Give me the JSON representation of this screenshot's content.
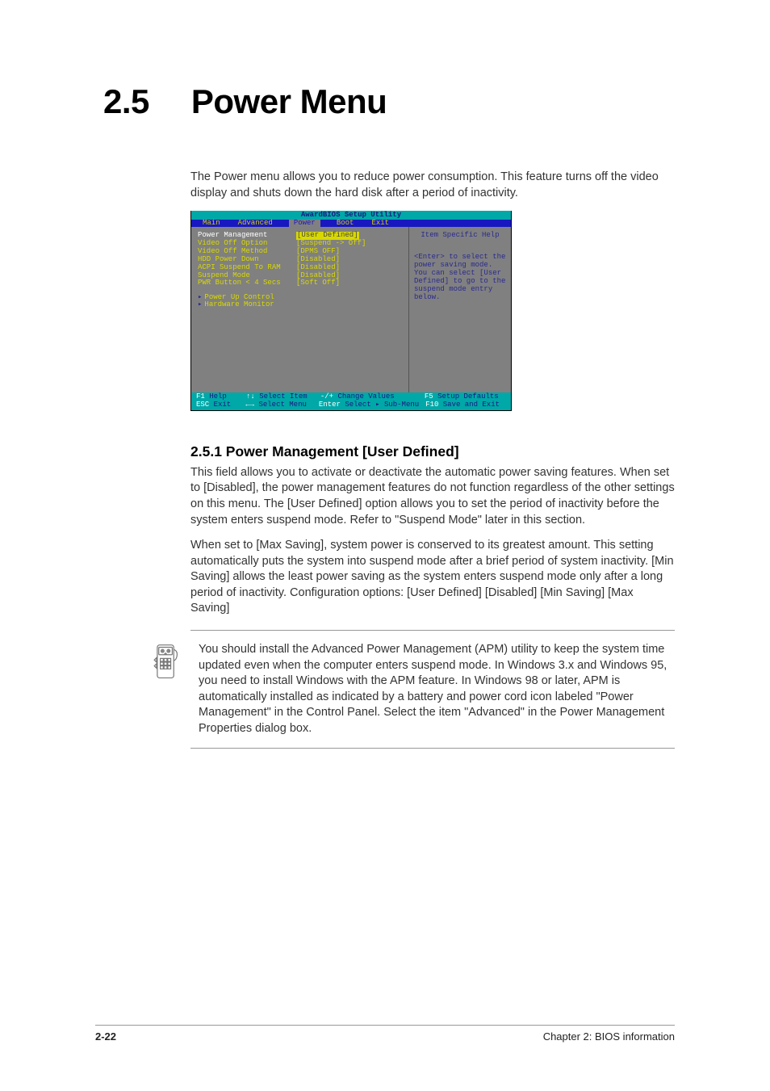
{
  "heading": {
    "number": "2.5",
    "title": "Power Menu"
  },
  "intro": "The Power menu allows you to reduce power consumption. This feature turns off the video display and shuts down the hard disk after a period of inactivity.",
  "bios": {
    "title": "AwardBIOS Setup Utility",
    "tabs": [
      "Main",
      "Advanced",
      "Power",
      "Boot",
      "Exit"
    ],
    "active_tab": "Power",
    "items": [
      {
        "label": "Power Management",
        "value": "[User Defined]",
        "selected": true
      },
      {
        "label": "Video Off Option",
        "value": "[Suspend -> Off]",
        "selected": false
      },
      {
        "label": "Video Off Method",
        "value": "[DPMS OFF]",
        "selected": false
      },
      {
        "label": "HDD Power Down",
        "value": "[Disabled]",
        "selected": false
      },
      {
        "label": "ACPI Suspend To RAM",
        "value": "[Disabled]",
        "selected": false
      },
      {
        "label": "",
        "value": "",
        "selected": false
      },
      {
        "label": "Suspend Mode",
        "value": "[Disabled]",
        "selected": false
      },
      {
        "label": "PWR Button < 4 Secs",
        "value": "[Soft Off]",
        "selected": false
      }
    ],
    "subitems": [
      "Power Up Control",
      "Hardware Monitor"
    ],
    "help_title": "Item Specific Help",
    "help_text": "<Enter> to select the power saving mode. You can select [User Defined] to go to the suspend mode entry below.",
    "footer": {
      "r1": [
        {
          "key": "F1",
          "label": "Help"
        },
        {
          "key": "↑↓",
          "label": "Select Item"
        },
        {
          "key": "-/+",
          "label": "Change Values"
        },
        {
          "key": "F5",
          "label": "Setup Defaults"
        }
      ],
      "r2": [
        {
          "key": "ESC",
          "label": "Exit"
        },
        {
          "key": "←→",
          "label": "Select Menu"
        },
        {
          "key": "Enter",
          "label": "Select ▸ Sub-Menu"
        },
        {
          "key": "F10",
          "label": "Save and Exit"
        }
      ]
    }
  },
  "sub1": {
    "title": "2.5.1 Power Management [User Defined]",
    "p1_pre": "This field allows you to activate or deactivate the automatic power saving features. When set to [Disabled], the power management features do not function regardless of the other settings on this menu. The [User Defined] option allows you to set the period of inactivity before the system enters suspend mode. Refer to \"Suspend Mode\" later in this section.",
    "p2": "When set to [Max Saving], system power is conserved to its greatest amount. This setting automatically puts the system into suspend mode after a brief period of system inactivity. [Min Saving] allows the least power saving as the system enters suspend mode only after a long period of inactivity. Configuration options: [User Defined] [Disabled] [Min Saving] [Max Saving]"
  },
  "note": {
    "text_pre": "You should install the Advanced Power Management (APM) utility to keep the system time updated even when the computer enters suspend mode. In Windows 3.x and Windows 95, you need to install Windows with the APM feature. In Windows 98 or later, APM is automatically installed as indicated by a battery and power cord icon labeled \"Power Management\" in the Control Panel. Select the item \"Advanced\" in the Power Management Properties dialog box."
  },
  "footer": {
    "left": "2-22",
    "right": "Chapter 2: BIOS information"
  }
}
